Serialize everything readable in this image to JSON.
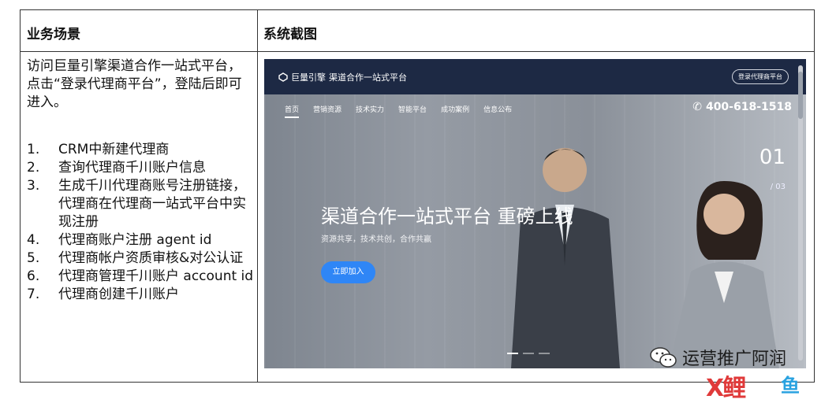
{
  "table": {
    "headers": {
      "left": "业务场景",
      "right": "系统截图"
    },
    "description": "访问巨量引擎渠道合作一站式平台，点击“登录代理商平台”，登陆后即可进入。",
    "steps": [
      {
        "num": "1.",
        "text": "CRM中新建代理商"
      },
      {
        "num": "2.",
        "text": "查询代理商千川账户信息"
      },
      {
        "num": "3.",
        "text": "生成千川代理商账号注册链接，代理商在代理商一站式平台中实现注册"
      },
      {
        "num": "4.",
        "text": "代理商账户注册 agent id"
      },
      {
        "num": "5.",
        "text": "代理商帐户资质审核&对公认证"
      },
      {
        "num": "6.",
        "text": "代理商管理千川账户 account id"
      },
      {
        "num": "7.",
        "text": "代理商创建千川账户"
      }
    ]
  },
  "screenshot": {
    "logo": "巨量引擎",
    "site_title": "渠道合作一站式平台",
    "login_button": "登录代理商平台",
    "nav": [
      "首页",
      "营销资源",
      "技术实力",
      "智能平台",
      "成功案例",
      "信息公布"
    ],
    "phone": "400-618-1518",
    "headline": "渠道合作一站式平台 重磅上线",
    "subheadline": "资源共享，技术共创，合作共赢",
    "cta": "立即加入",
    "slide_current": "01",
    "slide_total": "/ 03"
  },
  "watermark": {
    "text": "运营推广阿润",
    "logo_left": "X鲤",
    "logo_right": "鱼"
  }
}
